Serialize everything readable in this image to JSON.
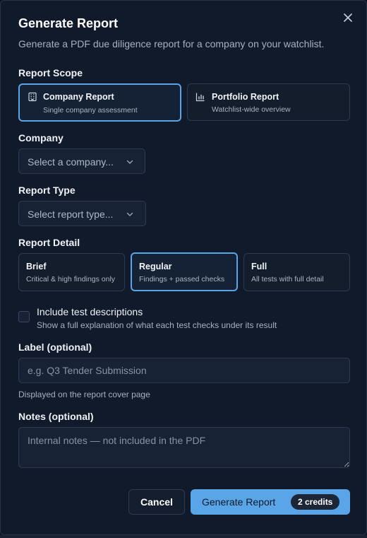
{
  "dialog": {
    "title": "Generate Report",
    "subtitle": "Generate a PDF due diligence report for a company on your watchlist.",
    "close_icon": "close-icon"
  },
  "scope": {
    "label": "Report Scope",
    "options": [
      {
        "title": "Company Report",
        "subtitle": "Single company assessment",
        "icon": "building-icon",
        "selected": true
      },
      {
        "title": "Portfolio Report",
        "subtitle": "Watchlist-wide overview",
        "icon": "bar-chart-icon",
        "selected": false
      }
    ]
  },
  "company": {
    "label": "Company",
    "placeholder": "Select a company..."
  },
  "report_type": {
    "label": "Report Type",
    "placeholder": "Select report type..."
  },
  "detail": {
    "label": "Report Detail",
    "options": [
      {
        "title": "Brief",
        "subtitle": "Critical & high findings only",
        "selected": false
      },
      {
        "title": "Regular",
        "subtitle": "Findings + passed checks",
        "selected": true
      },
      {
        "title": "Full",
        "subtitle": "All tests with full detail",
        "selected": false
      }
    ]
  },
  "include_descriptions": {
    "label": "Include test descriptions",
    "help": "Show a full explanation of what each test checks under its result",
    "checked": false
  },
  "label_field": {
    "label": "Label (optional)",
    "placeholder": "e.g. Q3 Tender Submission",
    "value": "",
    "help": "Displayed on the report cover page"
  },
  "notes_field": {
    "label": "Notes (optional)",
    "placeholder": "Internal notes — not included in the PDF",
    "value": ""
  },
  "actions": {
    "cancel_label": "Cancel",
    "generate_label": "Generate Report",
    "credits_badge": "2 credits"
  },
  "colors": {
    "accent": "#5aa5e8",
    "background": "#111a2a",
    "border": "#2c3a52"
  }
}
